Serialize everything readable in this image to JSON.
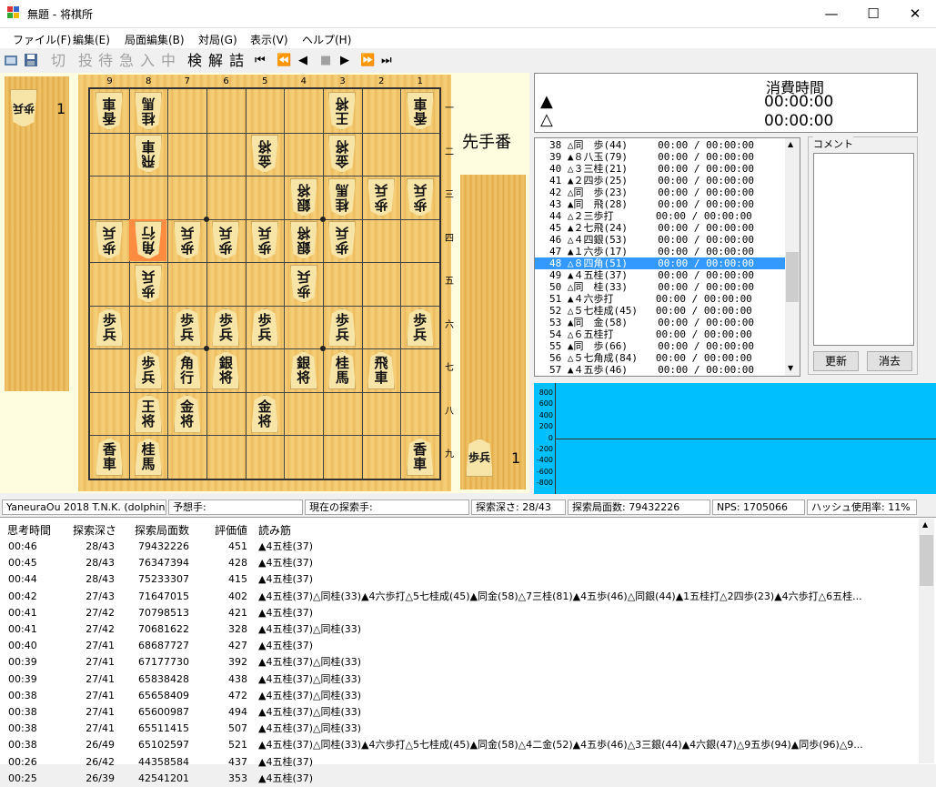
{
  "window": {
    "title": "無題 - 将棋所",
    "minimize": "—",
    "maximize": "☐",
    "close": "✕"
  },
  "menu": [
    "ファイル(F)",
    "編集(E)",
    "局面編集(B)",
    "対局(G)",
    "表示(V)",
    "ヘルプ(H)"
  ],
  "toolbar": {
    "cut": "切",
    "resign": "投",
    "wait": "待",
    "hurry": "急",
    "enter": "入",
    "stop": "中",
    "analyze": "検",
    "solve": "解",
    "mate": "詰",
    "nav": [
      "⏮",
      "⏪",
      "◀",
      "■",
      "▶",
      "⏩",
      "⏭"
    ]
  },
  "board": {
    "file_labels": [
      "9",
      "8",
      "7",
      "6",
      "5",
      "4",
      "3",
      "2",
      "1"
    ],
    "rank_labels": [
      "一",
      "二",
      "三",
      "四",
      "五",
      "六",
      "七",
      "八",
      "九"
    ],
    "gote_hand": {
      "piece": "歩兵",
      "count": "1"
    },
    "sente_hand": {
      "piece": "歩兵",
      "count": "1"
    },
    "turn_label": "先手番"
  },
  "time_panel": {
    "header": "消費時間",
    "sente_mark": "▲",
    "gote_mark": "△",
    "sente_time": "00:00:00",
    "gote_time": "00:00:00"
  },
  "kifu": {
    "rows": [
      "38 △同　歩(44)     00:00 / 00:00:00",
      "39 ▲８八玉(79)     00:00 / 00:00:00",
      "40 △３三桂(21)     00:00 / 00:00:00",
      "41 ▲２四歩(25)     00:00 / 00:00:00",
      "42 △同　歩(23)     00:00 / 00:00:00",
      "43 ▲同　飛(28)     00:00 / 00:00:00",
      "44 △２三歩打       00:00 / 00:00:00",
      "45 ▲２七飛(24)     00:00 / 00:00:00",
      "46 △４四銀(53)     00:00 / 00:00:00",
      "47 ▲１六歩(17)     00:00 / 00:00:00",
      "48 △８四角(51)     00:00 / 00:00:00",
      "49 ▲４五桂(37)     00:00 / 00:00:00",
      "50 △同　桂(33)     00:00 / 00:00:00",
      "51 ▲４六歩打       00:00 / 00:00:00",
      "52 △５七桂成(45)   00:00 / 00:00:00",
      "53 ▲同　金(58)     00:00 / 00:00:00",
      "54 △６五桂打       00:00 / 00:00:00",
      "55 ▲同　歩(66)     00:00 / 00:00:00",
      "56 △５七角成(84)   00:00 / 00:00:00",
      "57 ▲４五歩(46)     00:00 / 00:00:00"
    ],
    "selected_index": 10
  },
  "comment": {
    "label": "コメント",
    "update_button": "更新",
    "clear_button": "消去"
  },
  "eval_graph": {
    "y_ticks": [
      "800",
      "600",
      "400",
      "200",
      "0",
      "-200",
      "-400",
      "-600",
      "-800"
    ]
  },
  "status": {
    "engine": "YaneuraOu 2018 T.N.K. (dolphin)...",
    "predicted": "予想手:",
    "current": "現在の探索手:",
    "depth": "探索深さ: 28/43",
    "nodes": "探索局面数: 79432226",
    "nps": "NPS: 1705066",
    "hash": "ハッシュ使用率: 11%"
  },
  "thinking": {
    "headers": [
      "思考時間",
      "探索深さ",
      "探索局面数",
      "評価値",
      "読み筋"
    ],
    "rows": [
      [
        "00:46",
        "28/43",
        "79432226",
        "451",
        "▲4五桂(37)"
      ],
      [
        "00:45",
        "28/43",
        "76347394",
        "428",
        "▲4五桂(37)"
      ],
      [
        "00:44",
        "28/43",
        "75233307",
        "415",
        "▲4五桂(37)"
      ],
      [
        "00:42",
        "27/43",
        "71647015",
        "402",
        "▲4五桂(37)△同桂(33)▲4六歩打△5七桂成(45)▲同金(58)△7三桂(81)▲4五歩(46)△同銀(44)▲1五桂打△2四歩(23)▲4六歩打△6五桂..."
      ],
      [
        "00:41",
        "27/42",
        "70798513",
        "421",
        "▲4五桂(37)"
      ],
      [
        "00:41",
        "27/42",
        "70681622",
        "328",
        "▲4五桂(37)△同桂(33)"
      ],
      [
        "00:40",
        "27/41",
        "68687727",
        "427",
        "▲4五桂(37)"
      ],
      [
        "00:39",
        "27/41",
        "67177730",
        "392",
        "▲4五桂(37)△同桂(33)"
      ],
      [
        "00:39",
        "27/41",
        "65838428",
        "438",
        "▲4五桂(37)△同桂(33)"
      ],
      [
        "00:38",
        "27/41",
        "65658409",
        "472",
        "▲4五桂(37)△同桂(33)"
      ],
      [
        "00:38",
        "27/41",
        "65600987",
        "494",
        "▲4五桂(37)△同桂(33)"
      ],
      [
        "00:38",
        "27/41",
        "65511415",
        "507",
        "▲4五桂(37)△同桂(33)"
      ],
      [
        "00:38",
        "26/49",
        "65102597",
        "521",
        "▲4五桂(37)△同桂(33)▲4六歩打△5七桂成(45)▲同金(58)△4二金(52)▲4五歩(46)△3三銀(44)▲4六銀(47)△9五歩(94)▲同歩(96)△9..."
      ],
      [
        "00:26",
        "26/42",
        "44358584",
        "437",
        "▲4五桂(37)"
      ],
      [
        "00:25",
        "26/39",
        "42541201",
        "353",
        "▲4五桂(37)"
      ]
    ]
  },
  "pieces": [
    {
      "f": 9,
      "r": 1,
      "t": "香車",
      "g": true
    },
    {
      "f": 8,
      "r": 1,
      "t": "桂馬",
      "g": true
    },
    {
      "f": 3,
      "r": 1,
      "t": "王将",
      "g": true
    },
    {
      "f": 1,
      "r": 1,
      "t": "香車",
      "g": true
    },
    {
      "f": 8,
      "r": 2,
      "t": "飛車",
      "g": true
    },
    {
      "f": 5,
      "r": 2,
      "t": "金将",
      "g": true
    },
    {
      "f": 3,
      "r": 2,
      "t": "金将",
      "g": true
    },
    {
      "f": 4,
      "r": 3,
      "t": "銀将",
      "g": true
    },
    {
      "f": 3,
      "r": 3,
      "t": "桂馬",
      "g": true
    },
    {
      "f": 2,
      "r": 3,
      "t": "歩兵",
      "g": true
    },
    {
      "f": 1,
      "r": 3,
      "t": "歩兵",
      "g": true
    },
    {
      "f": 9,
      "r": 4,
      "t": "歩兵",
      "g": true
    },
    {
      "f": 8,
      "r": 4,
      "t": "角行",
      "g": true,
      "hl": true
    },
    {
      "f": 7,
      "r": 4,
      "t": "歩兵",
      "g": true
    },
    {
      "f": 6,
      "r": 4,
      "t": "歩兵",
      "g": true
    },
    {
      "f": 5,
      "r": 4,
      "t": "歩兵",
      "g": true
    },
    {
      "f": 4,
      "r": 4,
      "t": "銀将",
      "g": true
    },
    {
      "f": 3,
      "r": 4,
      "t": "歩兵",
      "g": true
    },
    {
      "f": 8,
      "r": 5,
      "t": "歩兵",
      "g": true
    },
    {
      "f": 4,
      "r": 5,
      "t": "歩兵",
      "g": true
    },
    {
      "f": 9,
      "r": 6,
      "t": "歩兵",
      "g": false
    },
    {
      "f": 7,
      "r": 6,
      "t": "歩兵",
      "g": false
    },
    {
      "f": 6,
      "r": 6,
      "t": "歩兵",
      "g": false
    },
    {
      "f": 5,
      "r": 6,
      "t": "歩兵",
      "g": false
    },
    {
      "f": 3,
      "r": 6,
      "t": "歩兵",
      "g": false
    },
    {
      "f": 1,
      "r": 6,
      "t": "歩兵",
      "g": false
    },
    {
      "f": 8,
      "r": 7,
      "t": "歩兵",
      "g": false
    },
    {
      "f": 7,
      "r": 7,
      "t": "角行",
      "g": false
    },
    {
      "f": 6,
      "r": 7,
      "t": "銀将",
      "g": false
    },
    {
      "f": 4,
      "r": 7,
      "t": "銀将",
      "g": false
    },
    {
      "f": 3,
      "r": 7,
      "t": "桂馬",
      "g": false
    },
    {
      "f": 2,
      "r": 7,
      "t": "飛車",
      "g": false
    },
    {
      "f": 8,
      "r": 8,
      "t": "王将",
      "g": false
    },
    {
      "f": 7,
      "r": 8,
      "t": "金将",
      "g": false
    },
    {
      "f": 5,
      "r": 8,
      "t": "金将",
      "g": false
    },
    {
      "f": 9,
      "r": 9,
      "t": "香車",
      "g": false
    },
    {
      "f": 8,
      "r": 9,
      "t": "桂馬",
      "g": false
    },
    {
      "f": 1,
      "r": 9,
      "t": "香車",
      "g": false
    }
  ]
}
